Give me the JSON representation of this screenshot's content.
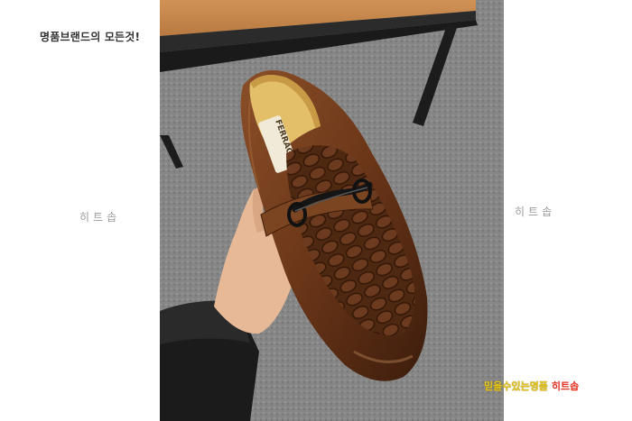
{
  "tagline": "명품브랜드의 모든것!",
  "watermark_left": "히트솝",
  "watermark_right": "히트솝",
  "caption": {
    "part1": "믿을수있는명품",
    "part2": "히트솝"
  },
  "insole_brand": "FERRAG",
  "colors": {
    "leather": "#6b3a1e",
    "floor": "#8c8c8c",
    "table_top": "#c98a4a"
  }
}
